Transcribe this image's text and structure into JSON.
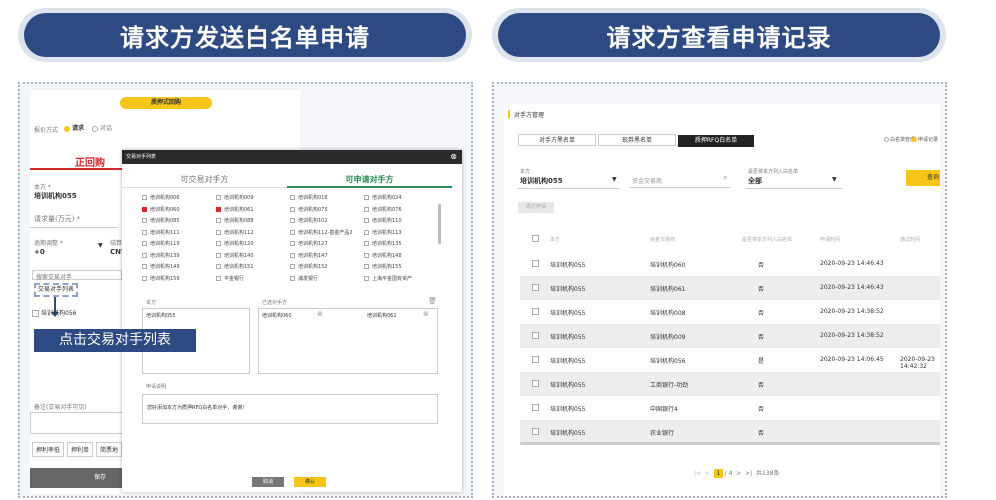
{
  "left_title": "请求方发送白名单申请",
  "right_title": "请求方查看申请记录",
  "left": {
    "top_button": "质押式回购",
    "quote_mode_label": "报价方式",
    "radio_request": "请求",
    "radio_reply": "对话",
    "tab_forward": "正回购",
    "party_label": "本方 *",
    "party_value": "培训机构055",
    "amount_placeholder": "请求量(万元) *",
    "term_label": "逾期调整 *",
    "term_value": "+0",
    "currency_label": "结算币",
    "currency_value": "CNY",
    "search_counterparty_placeholder": "搜索交易对手",
    "counterparty_list_button": "交易对手列表",
    "checkbox_item": "培训机构056",
    "callout": "点击交易对手列表",
    "remark_label": "备注(交易对手可见)",
    "footer_buttons": [
      "押利率低",
      "押利单",
      "简票地"
    ],
    "save_button": "保存"
  },
  "modal": {
    "header": "交易对手列表",
    "tab_tradable": "可交易对手方",
    "tab_apply": "可申请对手方",
    "grid": [
      [
        "培训机构006",
        "培训机构009",
        "培训机构018",
        "培训机构024"
      ],
      [
        "培训机构060",
        "培训机构061",
        "培训机构075",
        "培训机构076"
      ],
      [
        "培训机构085",
        "培训机构088",
        "培训机构102",
        "培训机构110"
      ],
      [
        "培训机构111",
        "培训机构112",
        "培训机构112-基金产品2",
        "培训机构113"
      ],
      [
        "培训机构119",
        "培训机构120",
        "培训机构127",
        "培训机构135"
      ],
      [
        "培训机构139",
        "培训机构140",
        "培训机构147",
        "培训机构148"
      ],
      [
        "培训机构149",
        "培训机构151",
        "培训机构152",
        "培训机构155"
      ],
      [
        "培训机构159",
        "平金银行",
        "浦发银行",
        "上海平金国有资产"
      ]
    ],
    "checked": [
      [
        1,
        0
      ],
      [
        1,
        1
      ]
    ],
    "self_label": "本方",
    "selected_label": "已选对手方",
    "self_value": "培训机构055",
    "selected_values": [
      "培训机构060",
      "培训机构061"
    ],
    "note_label": "申请说明",
    "note_text": "您好添加本方为质押RFQ白名单对手，谢谢!",
    "cancel_button": "取消",
    "confirm_button": "确认"
  },
  "right": {
    "section_title": "对手方管理",
    "tabs": [
      "对手方黑名单",
      "现券黑名单",
      "质押RFQ白名单"
    ],
    "radio_whitelist": "白名单管理",
    "radio_records": "申请记录",
    "filter_party_label": "本方",
    "filter_party_value": "培训机构055",
    "filter_counterparty_placeholder": "资金交易商",
    "filter_status_label": "是否将本方列入白名单",
    "filter_status_value": "全部",
    "query_button": "查询",
    "batch_button": "再次申请",
    "columns": [
      "本方",
      "资金交易商",
      "是否将本方列入白名单",
      "申请时间",
      "通过时间"
    ],
    "rows": [
      [
        "培训机构055",
        "培训机构060",
        "否",
        "2020-09-23 14:46:43",
        ""
      ],
      [
        "培训机构055",
        "培训机构061",
        "否",
        "2020-09-23 14:46:43",
        ""
      ],
      [
        "培训机构055",
        "培训机构008",
        "否",
        "2020-09-23 14:38:52",
        ""
      ],
      [
        "培训机构055",
        "培训机构009",
        "否",
        "2020-09-23 14:38:52",
        ""
      ],
      [
        "培训机构055",
        "培训机构056",
        "是",
        "2020-09-23 14:06:45",
        "2020-09-23 14:42:32"
      ],
      [
        "培训机构055",
        "工商银行-功劲",
        "否",
        "",
        ""
      ],
      [
        "培训机构055",
        "中国银行4",
        "否",
        "",
        ""
      ],
      [
        "培训机构055",
        "农业银行",
        "否",
        "",
        ""
      ]
    ],
    "pagination": {
      "current": "1",
      "total_pages": "/ 4",
      "total": "共138条"
    }
  },
  "colors": {
    "banner": "#2e4a83",
    "accent": "#f5c518",
    "green": "#2a8a55",
    "red": "#d62a2a"
  }
}
